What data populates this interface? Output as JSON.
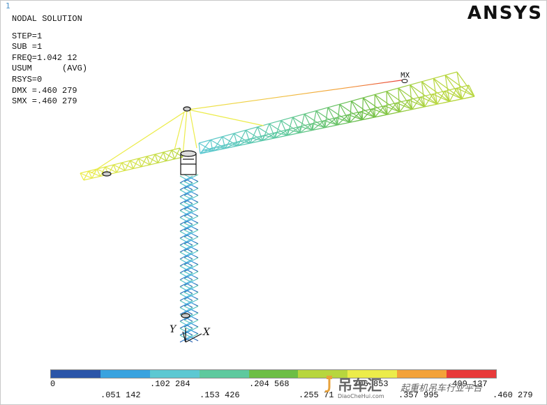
{
  "window_number": "1",
  "logo_text": "ANSYS",
  "header": {
    "title": "NODAL SOLUTION",
    "lines": [
      "STEP=1",
      "SUB =1",
      "FREQ=1.042 12",
      "USUM      (AVG)",
      "RSYS=0",
      "DMX =.460 279",
      "SMX =.460 279"
    ]
  },
  "markers": {
    "max_label": "MX",
    "axis_y": "Y",
    "axis_x": "X"
  },
  "legend": {
    "colors": [
      "#2b55a8",
      "#3aa3df",
      "#5cc8d2",
      "#5ec99e",
      "#6dbe45",
      "#b7d63e",
      "#ecec4a",
      "#f3a23a",
      "#e83a3a"
    ],
    "ticks_top": [
      "0",
      ".102 284",
      ".204 568",
      ".306 853",
      ".409 137"
    ],
    "ticks_bottom": [
      ".051 142",
      ".153 426",
      ".255 71",
      ".357 995",
      ".460 279"
    ]
  },
  "watermark": {
    "brand": "吊车汇",
    "url": "DiaoCheHui.com",
    "slogan": "起重机吊车行业平台"
  }
}
